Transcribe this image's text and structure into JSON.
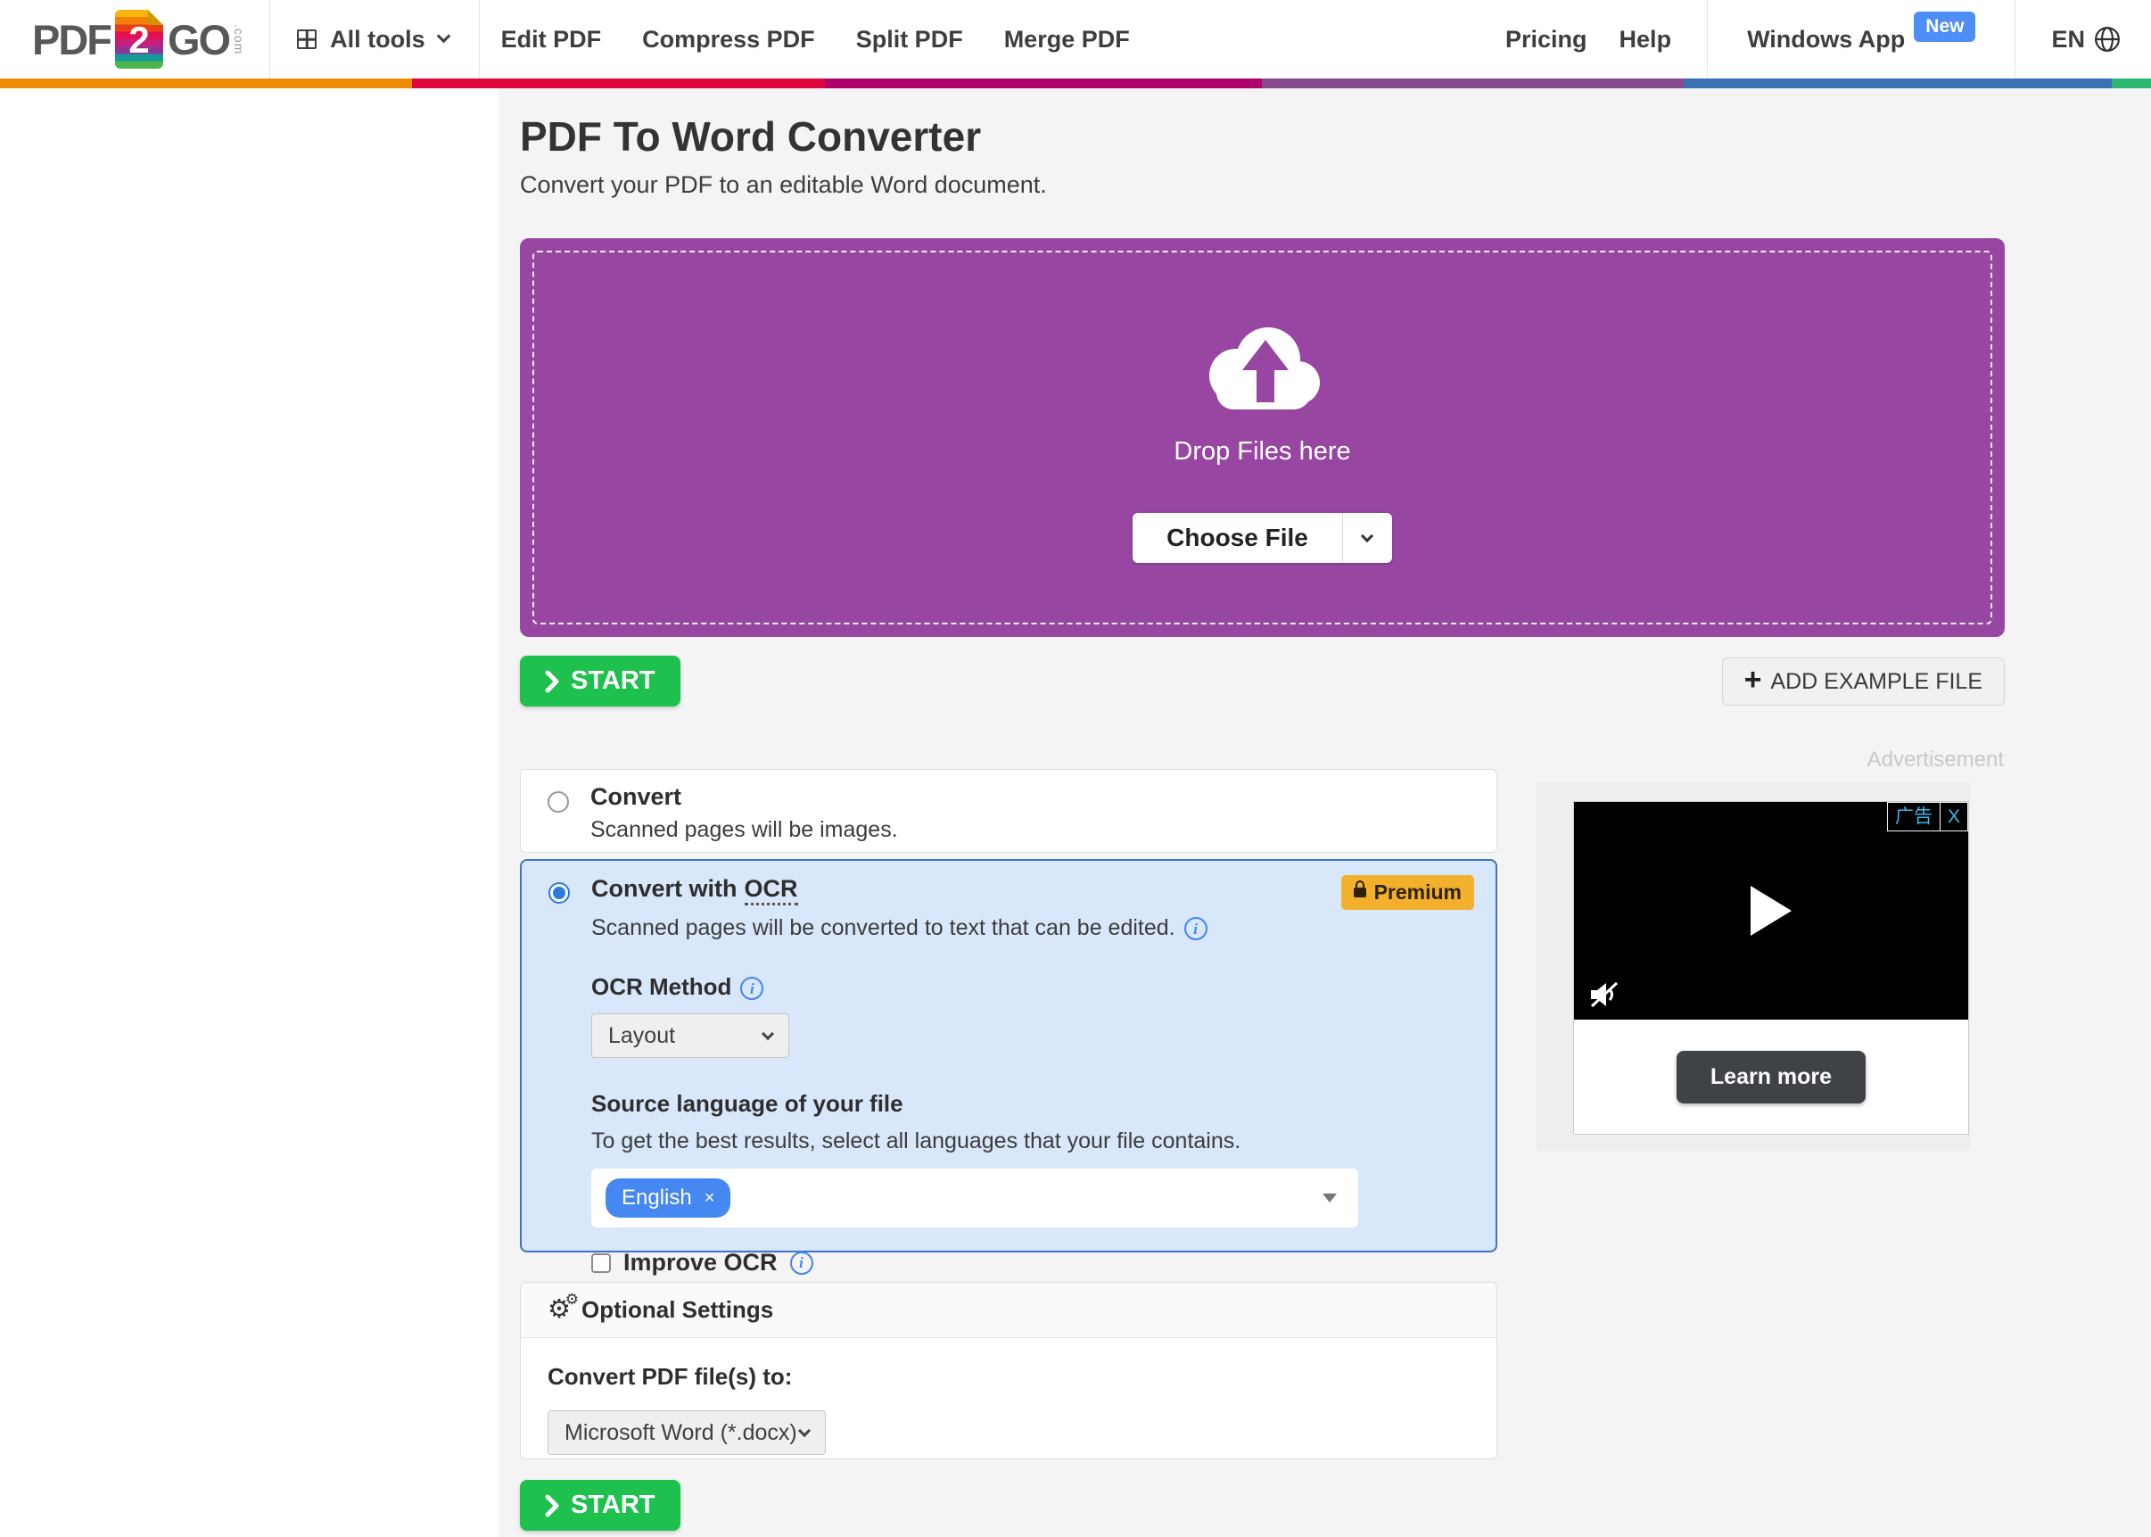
{
  "header": {
    "logo": {
      "pdf": "PDF",
      "digit": "2",
      "go": "GO",
      "tld": ".com"
    },
    "all_tools": "All tools",
    "nav": [
      "Edit PDF",
      "Compress PDF",
      "Split PDF",
      "Merge PDF"
    ],
    "pricing": "Pricing",
    "help": "Help",
    "windows_app": "Windows App",
    "new_badge": "New",
    "language": "EN"
  },
  "hero": {
    "title": "PDF To Word Converter",
    "subtitle": "Convert your PDF to an editable Word document."
  },
  "dropzone": {
    "drop_label": "Drop Files here",
    "choose_file": "Choose File"
  },
  "buttons": {
    "start": "START",
    "add_example": "ADD EXAMPLE FILE",
    "plus": "+"
  },
  "convert_option": {
    "label": "Convert",
    "description": "Scanned pages will be images."
  },
  "ocr_option": {
    "label": "Convert with",
    "label_ocr": "OCR",
    "premium": "Premium",
    "description": "Scanned pages will be converted to text that can be edited.",
    "info_glyph": "i",
    "method_label": "OCR Method",
    "method_value": "Layout",
    "language_label": "Source language of your file",
    "language_hint": "To get the best results, select all languages that your file contains.",
    "selected_language": "English",
    "remove_tag": "×",
    "improve_label": "Improve OCR"
  },
  "optional_settings": {
    "header": "Optional Settings",
    "gear_glyph": "⚙",
    "convert_to_label": "Convert PDF file(s) to:",
    "format_value": "Microsoft Word (*.docx)"
  },
  "ad": {
    "label": "Advertisement",
    "badge": "广告",
    "close": "X",
    "cta": "Learn more"
  },
  "colors": {
    "dropzone_purple": "#9747a1",
    "start_green": "#1ec04e",
    "selected_blue": "#2a7ae2",
    "ocr_card_bg": "#d9e7fa",
    "ocr_card_border": "#3b74c9",
    "premium_yellow": "#f2b02c",
    "language_tag_blue": "#4688f1",
    "new_badge_blue": "#4f8ef7"
  }
}
